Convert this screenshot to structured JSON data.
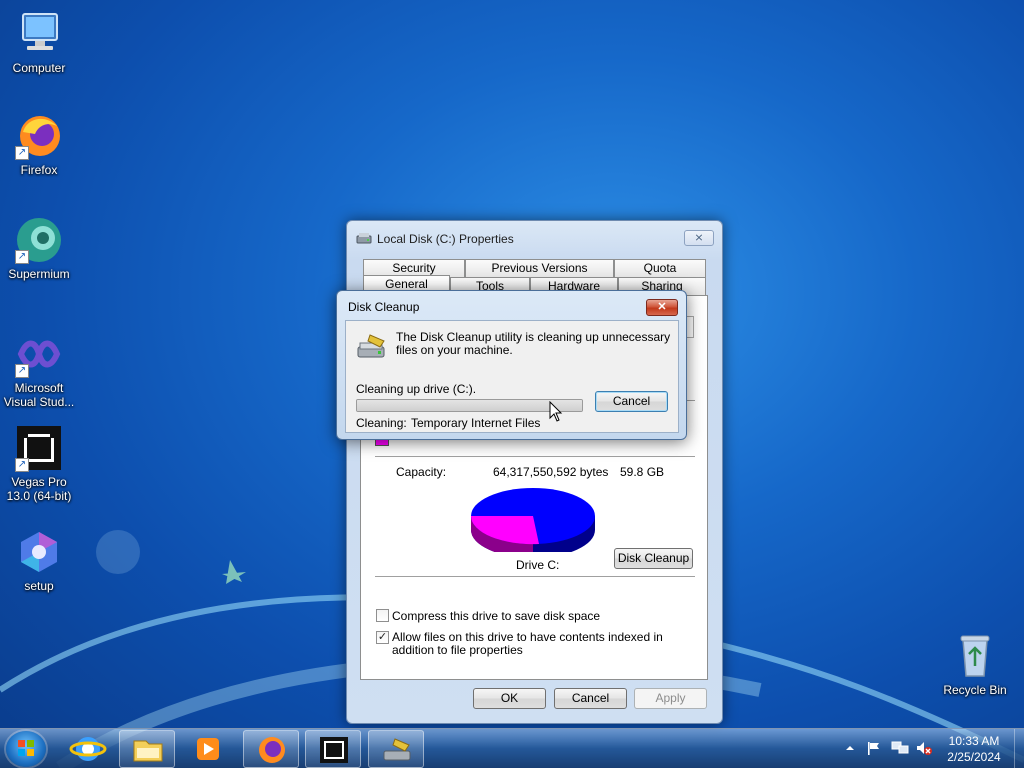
{
  "desktop": {
    "icons": [
      {
        "label": "Computer",
        "icon": "computer-icon"
      },
      {
        "label": "Firefox",
        "icon": "firefox-icon"
      },
      {
        "label": "Supermium",
        "icon": "supermium-icon"
      },
      {
        "label": "Microsoft Visual Stud...",
        "icon": "visual-studio-icon"
      },
      {
        "label": "Vegas Pro 13.0 (64-bit)",
        "icon": "vegas-pro-icon"
      },
      {
        "label": "setup",
        "icon": "office-setup-icon"
      },
      {
        "label": "Recycle Bin",
        "icon": "recycle-bin-icon"
      }
    ]
  },
  "properties_dialog": {
    "title": "Local Disk (C:) Properties",
    "close_label": "⨯",
    "tabs_row1": [
      "Security",
      "Previous Versions",
      "Quota"
    ],
    "tabs_row2": [
      "General",
      "Tools",
      "Hardware",
      "Sharing"
    ],
    "active_tab": "General",
    "capacity_label": "Capacity:",
    "capacity_bytes": "64,317,550,592 bytes",
    "capacity_gb": "59.8 GB",
    "drive_label": "Drive C:",
    "disk_cleanup_button": "Disk Cleanup",
    "compress_label": "Compress this drive to save disk space",
    "compress_checked": false,
    "index_label": "Allow files on this drive to have contents indexed in addition to file properties",
    "index_checked": true,
    "ok_button": "OK",
    "cancel_button": "Cancel",
    "apply_button": "Apply",
    "used_color": "#0000ff",
    "free_color": "#ff00ff"
  },
  "cleanup_dialog": {
    "title": "Disk Cleanup",
    "close_label": "✕",
    "message": "The Disk Cleanup utility is cleaning up unnecessary files on your machine.",
    "status": "Cleaning up drive  (C:).",
    "cancel_button": "Cancel",
    "cleaning_label": "Cleaning:",
    "cleaning_item": "Temporary Internet Files",
    "progress_percent": 100
  },
  "taskbar": {
    "items": [
      "start-button",
      "internet-explorer",
      "windows-explorer",
      "media-player",
      "firefox",
      "vegas-pro",
      "disk-cleanup"
    ],
    "time": "10:33 AM",
    "date": "2/25/2024"
  }
}
